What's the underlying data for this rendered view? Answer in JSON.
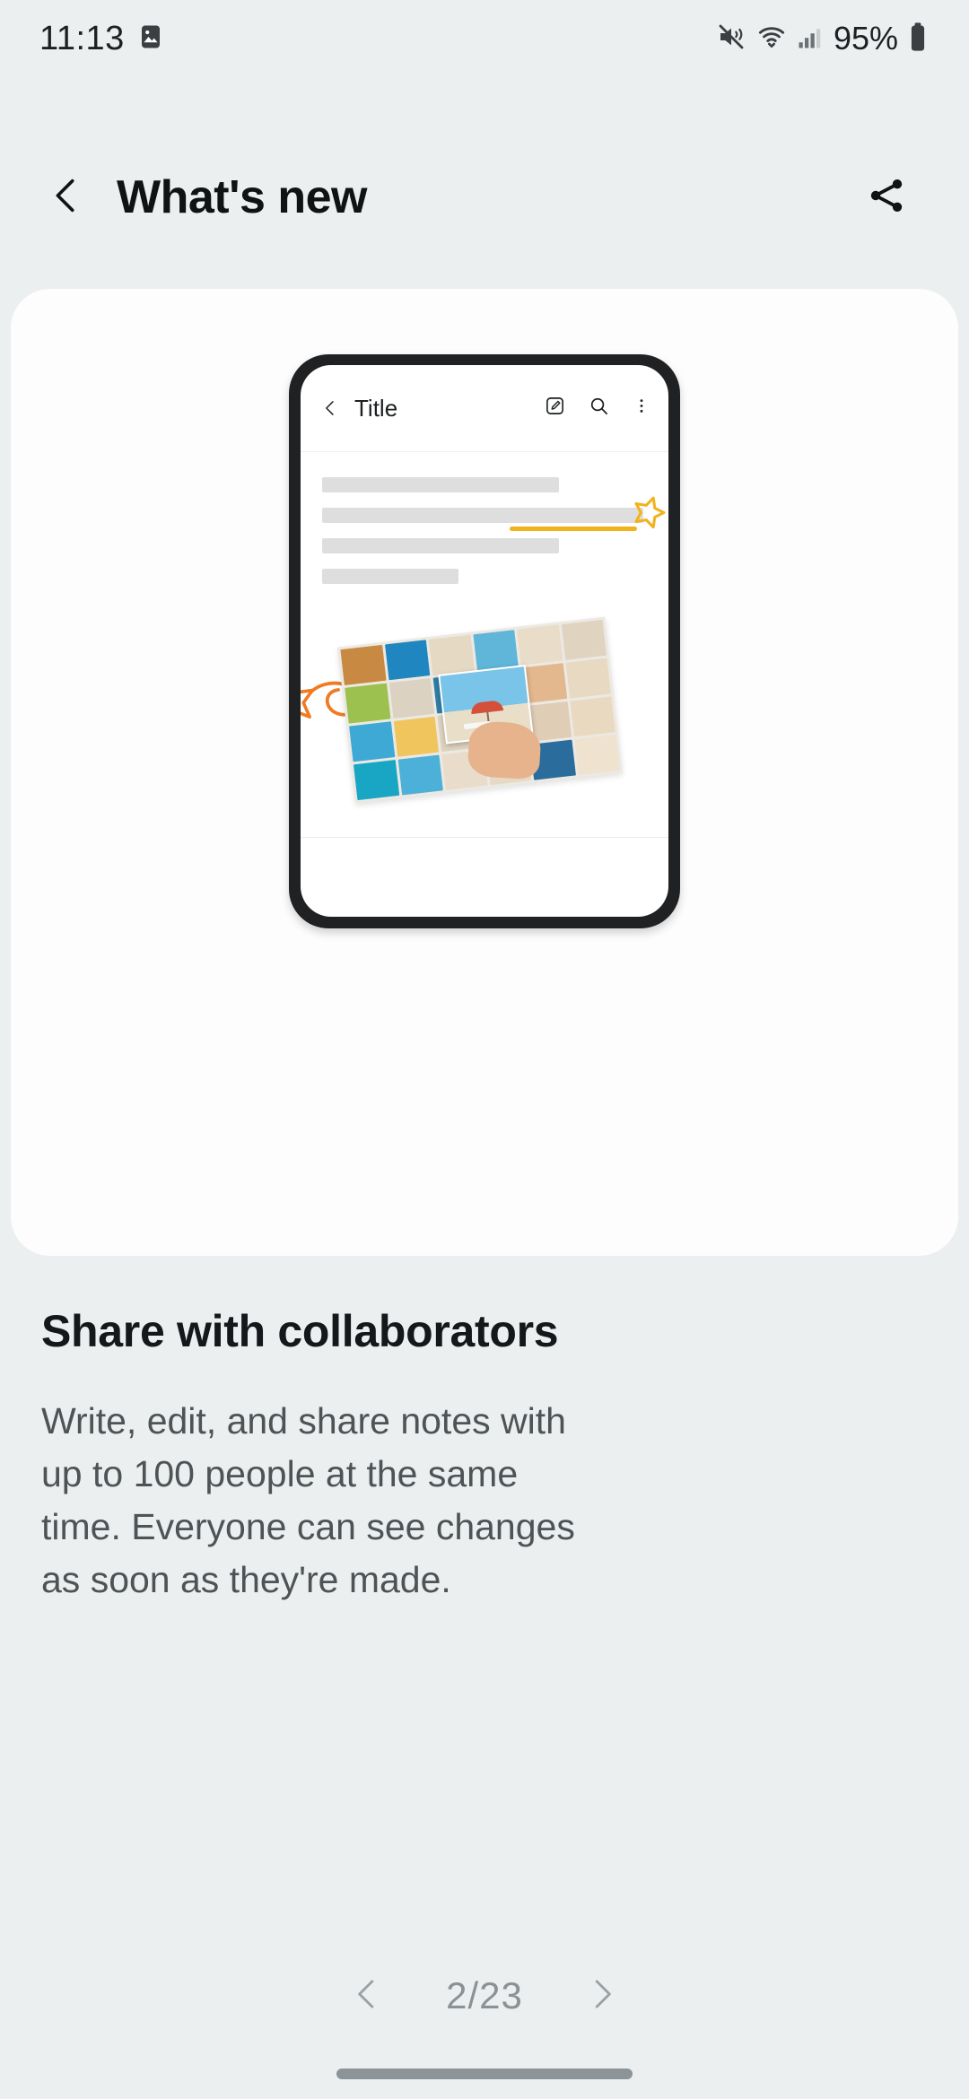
{
  "status_bar": {
    "time": "11:13",
    "battery_percent": "95%",
    "icons": [
      "image-icon",
      "mute-vibrate-icon",
      "wifi-icon",
      "signal-bars-icon",
      "battery-icon"
    ]
  },
  "header": {
    "title": "What's new",
    "back_icon": "chevron-left-icon",
    "share_icon": "share-icon"
  },
  "mockup": {
    "app_bar": {
      "back_icon": "chevron-left-icon",
      "title": "Title",
      "actions": [
        "compose-icon",
        "search-icon",
        "more-vertical-icon"
      ]
    },
    "collaborator_cursors": [
      {
        "name": "star-cursor-yellow",
        "color": "#f2b21c"
      },
      {
        "name": "star-cursor-orange",
        "color": "#ef7b23"
      }
    ]
  },
  "feature": {
    "title": "Share with collaborators",
    "description": "Write, edit, and share notes with up to 100 people at the same time. Everyone can see changes as soon as they're made."
  },
  "pager": {
    "prev_icon": "chevron-left-icon",
    "next_icon": "chevron-right-icon",
    "counter": "2/23",
    "current": 2,
    "total": 23
  },
  "colors": {
    "background": "#eceff0",
    "card": "#fdfdfd",
    "title_text": "#14181a",
    "body_text": "#4e5356",
    "pager_text": "#8b9194",
    "accent_yellow": "#f2b21c",
    "accent_orange": "#ef7b23"
  }
}
